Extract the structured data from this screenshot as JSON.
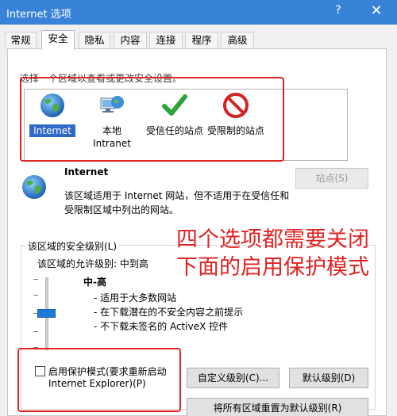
{
  "window": {
    "title": "Internet 选项",
    "help": "?",
    "close": "✕"
  },
  "tabs": [
    "常规",
    "安全",
    "隐私",
    "内容",
    "连接",
    "程序",
    "高级"
  ],
  "zones": {
    "instruction": "选择一个区域以查看或更改安全设置。",
    "items": [
      {
        "label": "Internet",
        "icon": "globe-icon"
      },
      {
        "label1": "本地",
        "label2": "Intranet",
        "icon": "computer-globe-icon"
      },
      {
        "label": "受信任的站点",
        "icon": "green-check-icon"
      },
      {
        "label": "受限制的站点",
        "icon": "no-entry-icon"
      }
    ]
  },
  "selected_zone": {
    "name": "Internet",
    "description": "该区域适用于 Internet 网站，但不适用于在受信任和受限制区域中列出的网站。",
    "sites_button": "站点(S)"
  },
  "security_level": {
    "legend": "该区域的安全级别(L)",
    "allowed": "该区域的允许级别: 中到高",
    "level": "中-高",
    "bullets": [
      "- 适用于大多数网站",
      "- 在下载潜在的不安全内容之前提示",
      "- 不下载未签名的 ActiveX 控件"
    ]
  },
  "protected_mode": {
    "label_line1": "启用保护模式(要求重新启动",
    "label_line2": "Internet Explorer)(P)",
    "checked": false
  },
  "buttons": {
    "custom_level": "自定义级别(C)...",
    "default_level": "默认级别(D)",
    "reset_all": "将所有区域重置为默认级别(R)"
  },
  "annotation": {
    "line1": "四个选项都需要关闭",
    "line2": "下面的启用保护模式",
    "color": "#e02424"
  },
  "colors": {
    "titlebar": "#3883d8",
    "selection": "#3069c8",
    "slider": "#1d7ad8"
  }
}
